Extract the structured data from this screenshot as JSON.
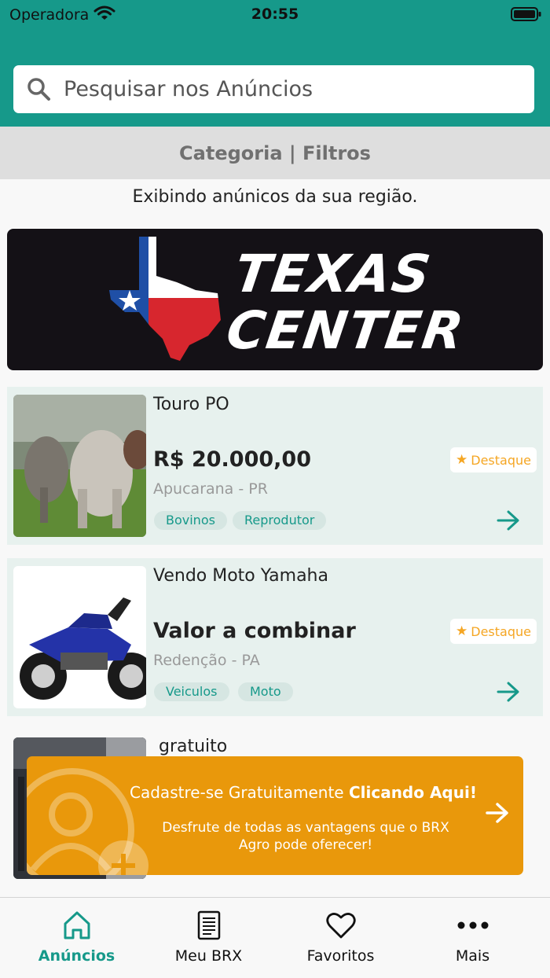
{
  "status_bar": {
    "carrier": "Operadora",
    "time": "20:55"
  },
  "search": {
    "placeholder": "Pesquisar nos Anúncios"
  },
  "filter_bar": {
    "label": "Categoria | Filtros"
  },
  "region_text": "Exibindo anúnicos da sua região.",
  "banner": {
    "line1": "TEXAS",
    "line2": "CENTER"
  },
  "listings": [
    {
      "title": "Touro PO",
      "price": "R$ 20.000,00",
      "location": "Apucarana - PR",
      "tags": [
        "Bovinos",
        "Reprodutor"
      ],
      "badge": "Destaque",
      "image": "cattle-photo"
    },
    {
      "title": "Vendo Moto Yamaha",
      "price": "Valor a combinar",
      "location": "Redenção - PA",
      "tags": [
        "Veiculos",
        "Moto"
      ],
      "badge": "Destaque",
      "image": "motorcycle-photo"
    },
    {
      "title": "gratuito",
      "image": "dark-photo"
    }
  ],
  "cta": {
    "line1_prefix": "Cadastre-se Gratuitamente",
    "line1_bold": "Clicando Aqui!",
    "line2": "Desfrute de todas as vantagens que o BRX Agro pode oferecer!"
  },
  "bottom_nav": [
    {
      "label": "Anúncios",
      "icon": "home-icon",
      "active": true
    },
    {
      "label": "Meu BRX",
      "icon": "document-icon",
      "active": false
    },
    {
      "label": "Favoritos",
      "icon": "heart-icon",
      "active": false
    },
    {
      "label": "Mais",
      "icon": "more-icon",
      "active": false
    }
  ],
  "colors": {
    "primary": "#16998a",
    "cta": "#e9980b",
    "badge": "#f5a623"
  }
}
